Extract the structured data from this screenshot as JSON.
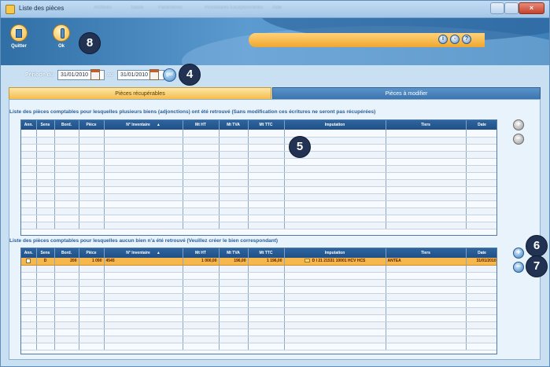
{
  "window": {
    "title": "Liste des pièces",
    "ghost_menu": [
      "Archives",
      "Saisie",
      "Paramètres",
      "Procédures Exceptionnelles",
      "Aide"
    ]
  },
  "toolbar": {
    "quit_label": "Quitter",
    "ok_label": "Ok"
  },
  "callouts": {
    "ok": "8",
    "go": "4",
    "grid_top": "5",
    "add": "6",
    "remove": "7"
  },
  "header_icons": [
    "information-icon",
    "navigation-icon",
    "help-icon"
  ],
  "periode": {
    "label_from": "Période du",
    "date_from": "31/01/2010",
    "label_to": "au",
    "date_to": "31/01/2010",
    "go_label": "go!"
  },
  "tabs": [
    {
      "label": "Pièces récupérables",
      "active": false
    },
    {
      "label": "Pièces à modifier",
      "active": true
    }
  ],
  "section_top": {
    "title": "Liste des pièces comptables pour lesquelles plusieurs biens (adjonctions) ont été retrouvé (Sans modification ces écritures  ne seront pas récupérées)"
  },
  "section_bottom": {
    "title": "Liste des pièces comptables pour lesquelles aucun bien n'a été retrouvé (Veuillez créer le bien correspondant)"
  },
  "columns": [
    "Ann.",
    "Sens",
    "Bord.",
    "Pièce",
    "N° Inventaire",
    "Mt HT",
    "Mt TVA",
    "Mt TTC",
    "Imputation",
    "Tiers",
    "Date"
  ],
  "bottom_rows": [
    {
      "ann": "",
      "sens": "D",
      "bord": "200",
      "piece": "1 090",
      "inventaire": "4545",
      "mt_ht": "1 000,00",
      "mt_tva": "196,00",
      "mt_ttc": "1 196,00",
      "imputation": "D I 21 21531 10001 HCV HCS",
      "tiers": "ANTEA",
      "date": "31/01/2010"
    }
  ],
  "colors": {
    "header_blue": "#2f6fa6",
    "tab_orange": "#f4bc4d",
    "selected_row": "#f6b84c",
    "grid_header": "#1f4f86",
    "badge": "#223253"
  }
}
